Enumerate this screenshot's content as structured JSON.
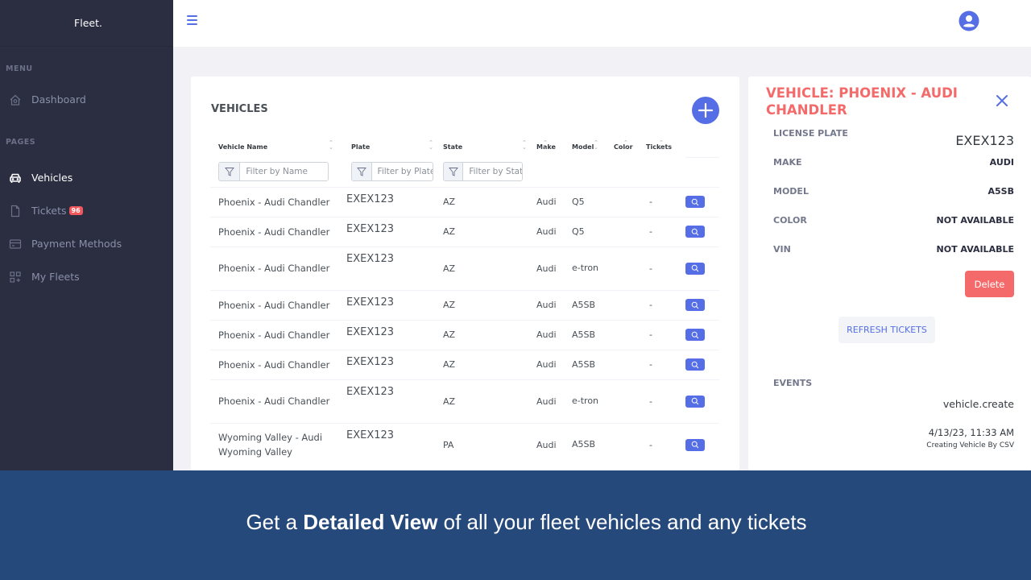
{
  "app": {
    "brand": "Fleet."
  },
  "sidebar": {
    "menu_title": "MENU",
    "pages_title": "PAGES",
    "items": [
      {
        "label": "Dashboard",
        "icon": "home-icon"
      },
      {
        "label": "Vehicles",
        "icon": "car-icon",
        "active": true
      },
      {
        "label": "Tickets",
        "icon": "file-icon",
        "badge": "96"
      },
      {
        "label": "Payment Methods",
        "icon": "credit-card-icon"
      },
      {
        "label": "My Fleets",
        "icon": "grid-add-icon"
      }
    ]
  },
  "topbar": {
    "menu_icon": "hamburger-icon",
    "user_icon": "user-circle-icon"
  },
  "vehicles": {
    "title": "VEHICLES",
    "add_icon": "plus-icon",
    "columns": [
      "Vehicle Name",
      "Plate",
      "State",
      "Make",
      "Model",
      "Color",
      "Tickets"
    ],
    "filters": {
      "name_placeholder": "Filter by Name",
      "plate_placeholder": "Filter by Plate",
      "state_placeholder": "Filter by State"
    },
    "rows": [
      {
        "name": "Phoenix - Audi Chandler",
        "plate": "EXEX123",
        "state": "AZ",
        "make": "Audi",
        "model": "Q5",
        "color": "",
        "tickets": "-"
      },
      {
        "name": "Phoenix - Audi Chandler",
        "plate": "EXEX123",
        "state": "AZ",
        "make": "Audi",
        "model": "Q5",
        "color": "",
        "tickets": "-"
      },
      {
        "name": "Phoenix - Audi Chandler",
        "plate": "EXEX123",
        "state": "AZ",
        "make": "Audi",
        "model": "e-tron",
        "color": "",
        "tickets": "-"
      },
      {
        "name": "Phoenix - Audi Chandler",
        "plate": "EXEX123",
        "state": "AZ",
        "make": "Audi",
        "model": "A5SB",
        "color": "",
        "tickets": "-"
      },
      {
        "name": "Phoenix - Audi Chandler",
        "plate": "EXEX123",
        "state": "AZ",
        "make": "Audi",
        "model": "A5SB",
        "color": "",
        "tickets": "-"
      },
      {
        "name": "Phoenix - Audi Chandler",
        "plate": "EXEX123",
        "state": "AZ",
        "make": "Audi",
        "model": "A5SB",
        "color": "",
        "tickets": "-"
      },
      {
        "name": "Phoenix - Audi Chandler",
        "plate": "EXEX123",
        "state": "AZ",
        "make": "Audi",
        "model": "e-tron",
        "color": "",
        "tickets": "-"
      },
      {
        "name": "Wyoming Valley - Audi Wyoming Valley",
        "plate": "EXEX123",
        "state": "PA",
        "make": "Audi",
        "model": "A5SB",
        "color": "",
        "tickets": "-"
      }
    ]
  },
  "detail": {
    "title": "VEHICLE: PHOENIX - AUDI CHANDLER",
    "fields": [
      {
        "label": "LICENSE PLATE",
        "value": "EXEX123"
      },
      {
        "label": "MAKE",
        "value": "AUDI"
      },
      {
        "label": "MODEL",
        "value": "A5SB"
      },
      {
        "label": "COLOR",
        "value": "NOT AVAILABLE"
      },
      {
        "label": "VIN",
        "value": "NOT AVAILABLE"
      }
    ],
    "delete_label": "Delete",
    "refresh_label": "REFRESH TICKETS",
    "events_label": "EVENTS",
    "events": [
      {
        "type": "vehicle.create",
        "timestamp": "4/13/23, 11:33 AM",
        "description": "Creating Vehicle By CSV"
      }
    ]
  },
  "banner": {
    "prefix": "Get a ",
    "bold": "Detailed View",
    "suffix": " of all your fleet vehicles and any tickets"
  },
  "colors": {
    "accent": "#556ee6",
    "danger": "#f46a6a",
    "sidebar": "#2a2e40",
    "banner": "#26497c"
  }
}
